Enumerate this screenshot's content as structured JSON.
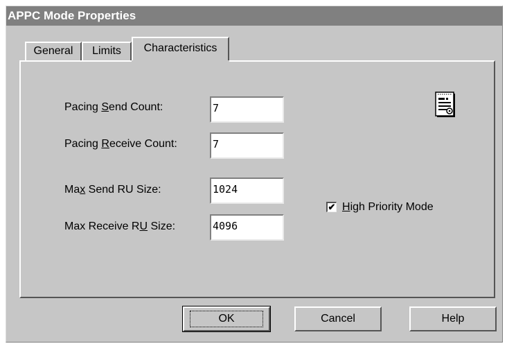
{
  "window": {
    "title": "APPC Mode Properties"
  },
  "tabs": [
    {
      "label": "General"
    },
    {
      "label": "Limits"
    },
    {
      "label": "Characteristics",
      "active": true
    }
  ],
  "fields": {
    "pacing_send": {
      "pre": "Pacing ",
      "ul": "S",
      "post": "end Count:",
      "value": "7"
    },
    "pacing_receive": {
      "pre": "Pacing ",
      "ul": "R",
      "post": "eceive Count:",
      "value": "7"
    },
    "max_send": {
      "pre": "Ma",
      "ul": "x",
      "post": " Send RU Size:",
      "value": "1024"
    },
    "max_receive": {
      "pre": "Max Receive R",
      "ul": "U",
      "post": " Size:",
      "value": "4096"
    }
  },
  "high_priority": {
    "ul": "H",
    "post": "igh Priority Mode",
    "checked": true,
    "check_glyph": "✔"
  },
  "buttons": {
    "ok": "OK",
    "cancel": "Cancel",
    "help": "Help"
  },
  "icons": {
    "properties": "properties-sheet-icon"
  }
}
